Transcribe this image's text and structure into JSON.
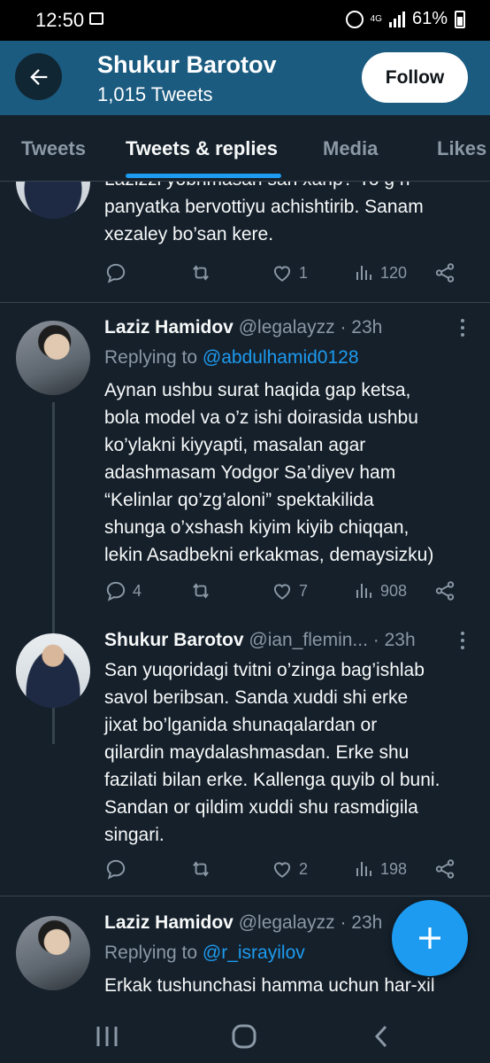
{
  "status_bar": {
    "time": "12:50",
    "network": "4G",
    "battery": "61%"
  },
  "header": {
    "profile_name": "Shukur Barotov",
    "tweet_count": "1,015 Tweets",
    "follow_label": "Follow",
    "banner_color": "#1b5b80"
  },
  "tabs": [
    {
      "label": "Tweets"
    },
    {
      "label": "Tweets & replies",
      "active": true
    },
    {
      "label": "Media"
    },
    {
      "label": "Likes"
    }
  ],
  "tweets": [
    {
      "partial": true,
      "text": "Lazizzi yobhmasan san xahp? Yo g ri\npanyatka bervottiyu achishtirib. Sanam\nxezaley bo’san kere.",
      "replies": "",
      "retweets": "",
      "likes": "1",
      "views": "120"
    },
    {
      "name": "Laziz Hamidov",
      "handle": "@legalayzz",
      "time": "· 23h",
      "replying_prefix": "Replying to ",
      "replying_to": "@abdulhamid0128",
      "text": "Aynan ushbu surat haqida gap ketsa,\nbola model va o’z ishi doirasida ushbu\nko’ylakni kiyyapti, masalan agar\nadashmasam Yodgor Sa’diyev ham\n“Kelinlar qo’zg’aloni” spektakilida\nshunga o’xshash kiyim kiyib chiqqan,\nlekin Asadbekni erkakmas, demaysizku)",
      "replies": "4",
      "retweets": "",
      "likes": "7",
      "views": "908"
    },
    {
      "name": "Shukur Barotov",
      "handle": "@ian_flemin...",
      "time": "· 23h",
      "text": "San yuqoridagi tvitni o’zinga bag’ishlab\nsavol beribsan. Sanda xuddi shi erke\njixat bo’lganida shunaqalardan or\nqilardin maydalashmasdan. Erke shu\nfazilati bilan erke. Kallenga quyib ol buni.\nSandan or qildim xuddi shu rasmdigila\nsingari.",
      "replies": "",
      "retweets": "",
      "likes": "2",
      "views": "198"
    },
    {
      "name": "Laziz Hamidov",
      "handle": "@legalayzz",
      "time": "· 23h",
      "replying_prefix": "Replying to ",
      "replying_to": "@r_israyilov",
      "text": "Erkak tushunchasi hamma uchun har-xil"
    }
  ],
  "colors": {
    "background": "#15202b",
    "accent": "#1d9bf0",
    "muted": "#8b98a5",
    "divider": "#38444d"
  }
}
